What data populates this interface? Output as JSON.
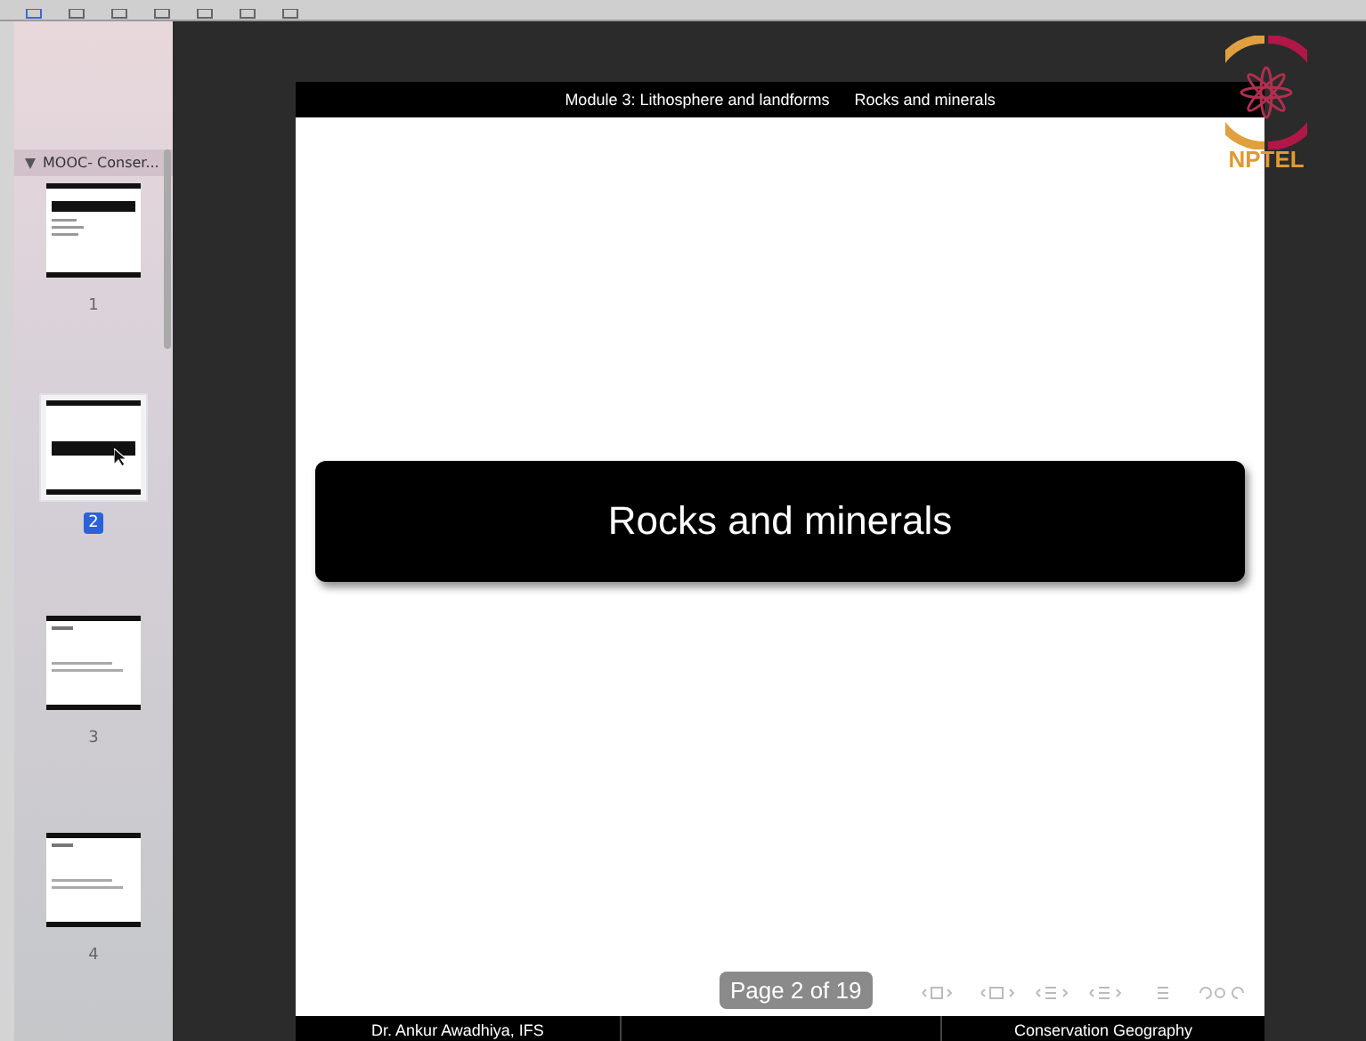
{
  "sidebar": {
    "title": "MOOC- Conser...",
    "expanded": true,
    "pages": [
      {
        "label": "1",
        "kind": "title",
        "selected": false
      },
      {
        "label": "2",
        "kind": "section",
        "selected": true
      },
      {
        "label": "3",
        "kind": "content",
        "selected": false
      },
      {
        "label": "4",
        "kind": "content",
        "selected": false
      }
    ]
  },
  "slide": {
    "header": [
      "Module 3: Lithosphere and landforms",
      "Rocks and minerals"
    ],
    "title": "Rocks and minerals",
    "footer": {
      "left": "Dr. Ankur Awadhiya, IFS",
      "right": "Conservation Geography"
    }
  },
  "page_indicator": "Page 2 of 19",
  "logo": {
    "text": "NPTEL"
  }
}
